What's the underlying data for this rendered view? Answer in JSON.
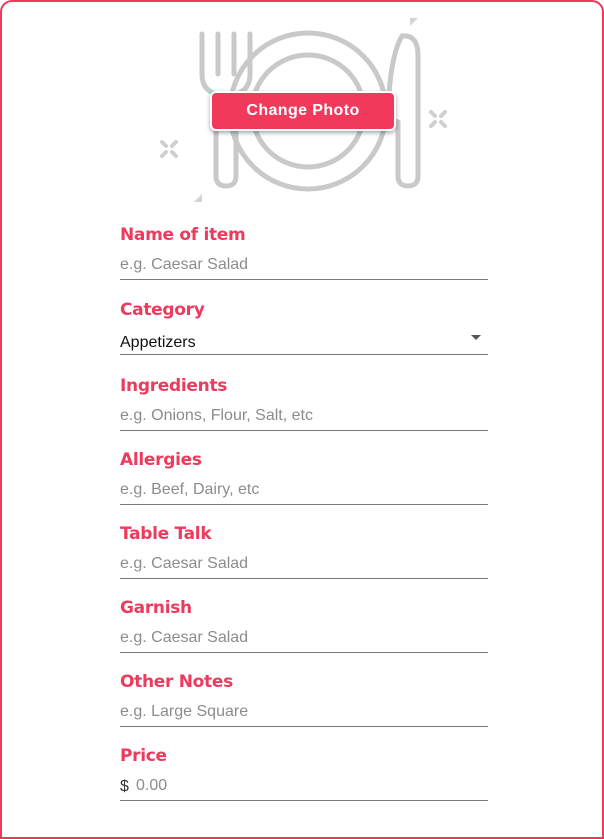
{
  "photo": {
    "placeholder_icon": "plate-fork-knife-icon",
    "change_label": "Change Photo"
  },
  "colors": {
    "accent": "#f2395c",
    "label": "#ee3a5c",
    "underline": "#7a7a7a",
    "placeholder": "#8c8c8c"
  },
  "fields": {
    "name": {
      "label": "Name of item",
      "placeholder": "e.g. Caesar Salad",
      "value": ""
    },
    "category": {
      "label": "Category",
      "value": "Appetizers"
    },
    "ingredients": {
      "label": "Ingredients",
      "placeholder": "e.g. Onions, Flour, Salt, etc",
      "value": ""
    },
    "allergies": {
      "label": "Allergies",
      "placeholder": "e.g. Beef, Dairy, etc",
      "value": ""
    },
    "table_talk": {
      "label": "Table Talk",
      "placeholder": "e.g. Caesar Salad",
      "value": ""
    },
    "garnish": {
      "label": "Garnish",
      "placeholder": "e.g. Caesar Salad",
      "value": ""
    },
    "other_notes": {
      "label": "Other Notes",
      "placeholder": "e.g. Large Square",
      "value": ""
    },
    "price": {
      "label": "Price",
      "prefix": "$",
      "placeholder": "0.00",
      "value": ""
    }
  }
}
